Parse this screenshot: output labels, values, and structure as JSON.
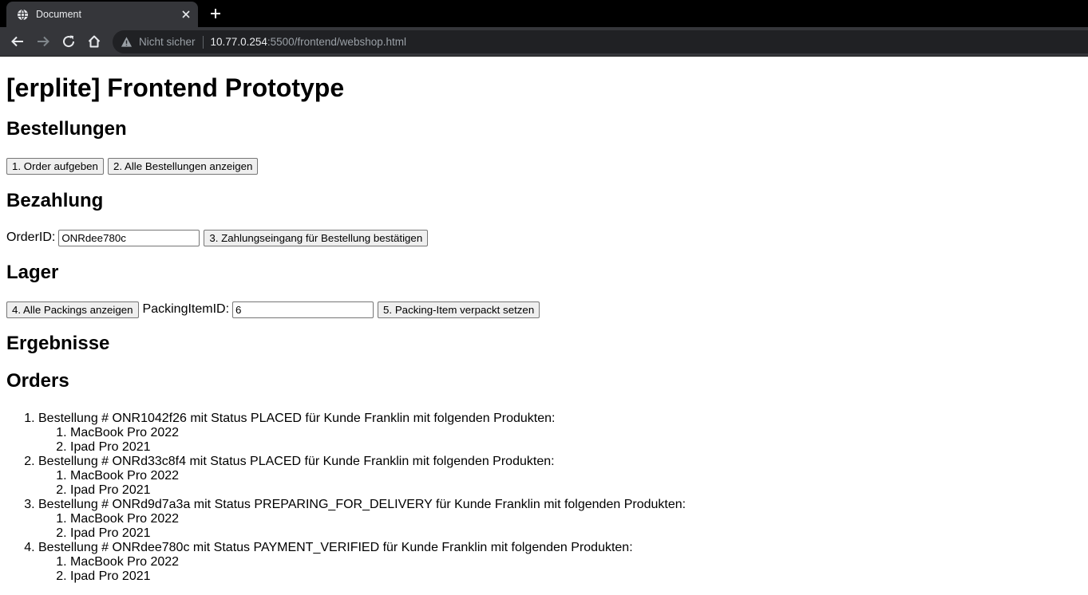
{
  "browser": {
    "tab_title": "Document",
    "security_label": "Nicht sicher",
    "url_host": "10.77.0.254",
    "url_rest": ":5500/frontend/webshop.html"
  },
  "page": {
    "title": "[erplite] Frontend Prototype",
    "bestellungen": {
      "heading": "Bestellungen",
      "order_button": "1. Order aufgeben",
      "list_button": "2. Alle Bestellungen anzeigen"
    },
    "bezahlung": {
      "heading": "Bezahlung",
      "orderid_label": "OrderID:",
      "orderid_value": "ONRdee780c",
      "confirm_button": "3. Zahlungseingang für Bestellung bestätigen"
    },
    "lager": {
      "heading": "Lager",
      "packings_button": "4. Alle Packings anzeigen",
      "packingitem_label": "PackingItemID:",
      "packingitem_value": "6",
      "pack_button": "5. Packing-Item verpackt setzen"
    },
    "ergebnisse": {
      "heading": "Ergebnisse"
    },
    "orders": {
      "heading": "Orders",
      "items": [
        {
          "text": "Bestellung # ONR1042f26 mit Status PLACED für Kunde Franklin mit folgenden Produkten:",
          "products": [
            "MacBook Pro 2022",
            "Ipad Pro 2021"
          ]
        },
        {
          "text": "Bestellung # ONRd33c8f4 mit Status PLACED für Kunde Franklin mit folgenden Produkten:",
          "products": [
            "MacBook Pro 2022",
            "Ipad Pro 2021"
          ]
        },
        {
          "text": "Bestellung # ONRd9d7a3a mit Status PREPARING_FOR_DELIVERY für Kunde Franklin mit folgenden Produkten:",
          "products": [
            "MacBook Pro 2022",
            "Ipad Pro 2021"
          ]
        },
        {
          "text": "Bestellung # ONRdee780c mit Status PAYMENT_VERIFIED für Kunde Franklin mit folgenden Produkten:",
          "products": [
            "MacBook Pro 2022",
            "Ipad Pro 2021"
          ]
        }
      ]
    }
  },
  "colors": {
    "tabbar_bg": "#000000",
    "toolbar_bg": "#35363a",
    "omnibox_bg": "#202124"
  },
  "icons": {
    "favicon": "globe-icon",
    "close": "close-icon",
    "new_tab": "plus-icon",
    "back": "back-arrow-icon",
    "forward": "forward-arrow-icon",
    "reload": "reload-icon",
    "home": "home-icon",
    "warning": "warning-icon"
  }
}
